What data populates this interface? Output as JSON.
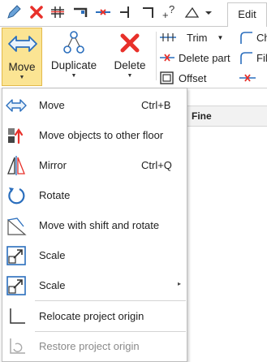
{
  "quick_access": {
    "icons": [
      "pencil-icon",
      "delete-x-icon",
      "dimension-icon",
      "wall-icon",
      "split-icon",
      "line-icon",
      "corner-icon",
      "info-icon",
      "angle-icon",
      "dropdown-icon"
    ]
  },
  "tabs": {
    "active": "Edit"
  },
  "ribbon": {
    "move_label": "Move",
    "duplicate_label": "Duplicate",
    "delete_label": "Delete",
    "trim_label": "Trim",
    "delete_part_label": "Delete part",
    "offset_label": "Offset",
    "cut_label": "Ch",
    "fill_label": "Fil"
  },
  "background": {
    "header_label": "Fine"
  },
  "menu": {
    "items": [
      {
        "label": "Move",
        "shortcut": "Ctrl+B",
        "icon": "move-arrows-icon"
      },
      {
        "label": "Move objects to other floor",
        "shortcut": "",
        "icon": "move-floor-icon"
      },
      {
        "label": "Mirror",
        "shortcut": "Ctrl+Q",
        "icon": "mirror-icon"
      },
      {
        "label": "Rotate",
        "shortcut": "",
        "icon": "rotate-icon"
      },
      {
        "label": "Move with shift and rotate",
        "shortcut": "",
        "icon": "shift-rotate-icon"
      },
      {
        "label": "Scale",
        "shortcut": "",
        "icon": "scale-icon"
      },
      {
        "label": "Scale",
        "shortcut": "",
        "icon": "scale-submenu-icon",
        "submenu_arrow": "▸"
      },
      {
        "label": "Relocate project origin",
        "shortcut": "",
        "icon": "origin-icon"
      },
      {
        "label": "Restore project origin",
        "shortcut": "",
        "icon": "restore-origin-icon",
        "disabled": true
      }
    ]
  },
  "colors": {
    "accent_highlight": "#fbe493",
    "icon_blue": "#2a6ebd",
    "delete_red": "#e8302a"
  }
}
